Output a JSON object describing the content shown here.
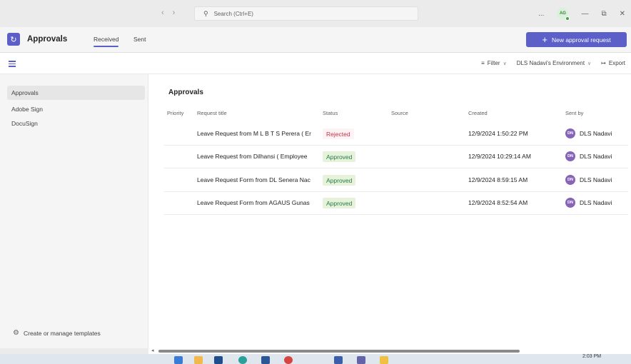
{
  "titlebar": {
    "search_placeholder": "Search (Ctrl+E)",
    "more_label": "...",
    "user_initials": "AG"
  },
  "app": {
    "title": "Approvals",
    "tabs": [
      {
        "label": "Received"
      },
      {
        "label": "Sent"
      }
    ],
    "new_button_label": "New approval request"
  },
  "toolbar": {
    "filter_label": "Filter",
    "environment_label": "DLS Nadavi's Environment",
    "export_label": "Export"
  },
  "sidebar": {
    "items": [
      {
        "label": "Approvals"
      },
      {
        "label": "Adobe Sign"
      },
      {
        "label": "DocuSign"
      }
    ],
    "templates_label": "Create or manage templates"
  },
  "main": {
    "title": "Approvals",
    "columns": {
      "priority": "Priority",
      "request_title": "Request title",
      "status": "Status",
      "source": "Source",
      "created": "Created",
      "sent_by": "Sent by"
    },
    "rows": [
      {
        "title": "Leave Request from M L B T S Perera ( Er",
        "status": "Rejected",
        "created": "12/9/2024 1:50:22 PM",
        "sender_initials": "DN",
        "sender": "DLS Nadavi"
      },
      {
        "title": "Leave Request from Dilhansi ( Employee",
        "status": "Approved",
        "created": "12/9/2024 10:29:14 AM",
        "sender_initials": "DN",
        "sender": "DLS Nadavi"
      },
      {
        "title": "Leave Request Form from DL Senera Nac",
        "status": "Approved",
        "created": "12/9/2024 8:59:15 AM",
        "sender_initials": "DN",
        "sender": "DLS Nadavi"
      },
      {
        "title": "Leave Request Form from AGAUS Gunas",
        "status": "Approved",
        "created": "12/9/2024 8:52:54 AM",
        "sender_initials": "DN",
        "sender": "DLS Nadavi"
      }
    ]
  },
  "taskbar": {
    "time": "2:03 PM"
  },
  "colors": {
    "accent": "#5b5fc7",
    "rejected": "#c4314b",
    "approved": "#237b4b",
    "avatar": "#8764b8"
  }
}
